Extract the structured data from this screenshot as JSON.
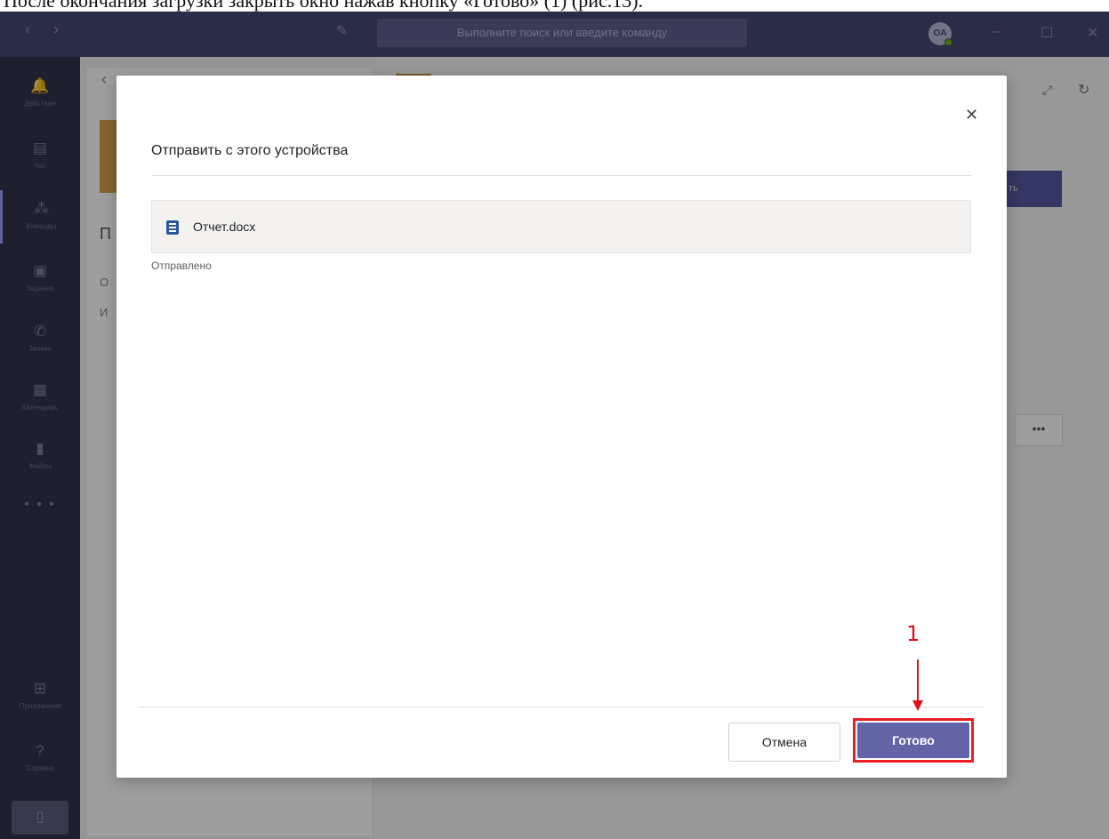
{
  "caption": "После окончания загрузки закрыть окно нажав кнопку «Готово» (1) (рис.13).",
  "titlebar": {
    "nav_back": "‹",
    "nav_forward": "›",
    "compose": "✎",
    "search_placeholder": "Выполните поиск или введите команду",
    "avatar_initials": "OA",
    "minimize": "–",
    "maximize": "☐",
    "close": "✕"
  },
  "rail": {
    "items": [
      {
        "icon": "🔔",
        "label": "Действия"
      },
      {
        "icon": "▤",
        "label": "Чат"
      },
      {
        "icon": "⁂",
        "label": "Команды"
      },
      {
        "icon": "▣",
        "label": "Задания"
      },
      {
        "icon": "✆",
        "label": "Звонки"
      },
      {
        "icon": "▦",
        "label": "Календарь"
      },
      {
        "icon": "▮",
        "label": "Файлы"
      }
    ],
    "more": "• • •",
    "apps": {
      "icon": "⊞",
      "label": "Приложения"
    },
    "help": {
      "icon": "?",
      "label": "Справка"
    },
    "device_icon": "▯"
  },
  "background": {
    "back_chevron": "‹",
    "heading_fragment": "П",
    "row1_fragment": "О",
    "row2_fragment": "И",
    "action_button_fragment": "ть",
    "ellipsis": "•••",
    "expand_icon": "⤢",
    "refresh_icon": "↻"
  },
  "dialog": {
    "title": "Отправить с этого устройства",
    "close": "✕",
    "file_name": "Отчет.docx",
    "file_status": "Отправлено",
    "cancel_label": "Отмена",
    "done_label": "Готово"
  },
  "annotation": {
    "number": "1"
  },
  "colors": {
    "titlebar": "#464775",
    "rail": "#33344a",
    "primary_button": "#6264a7",
    "annotation_red": "#e0101a",
    "word_icon": "#2b579a"
  }
}
